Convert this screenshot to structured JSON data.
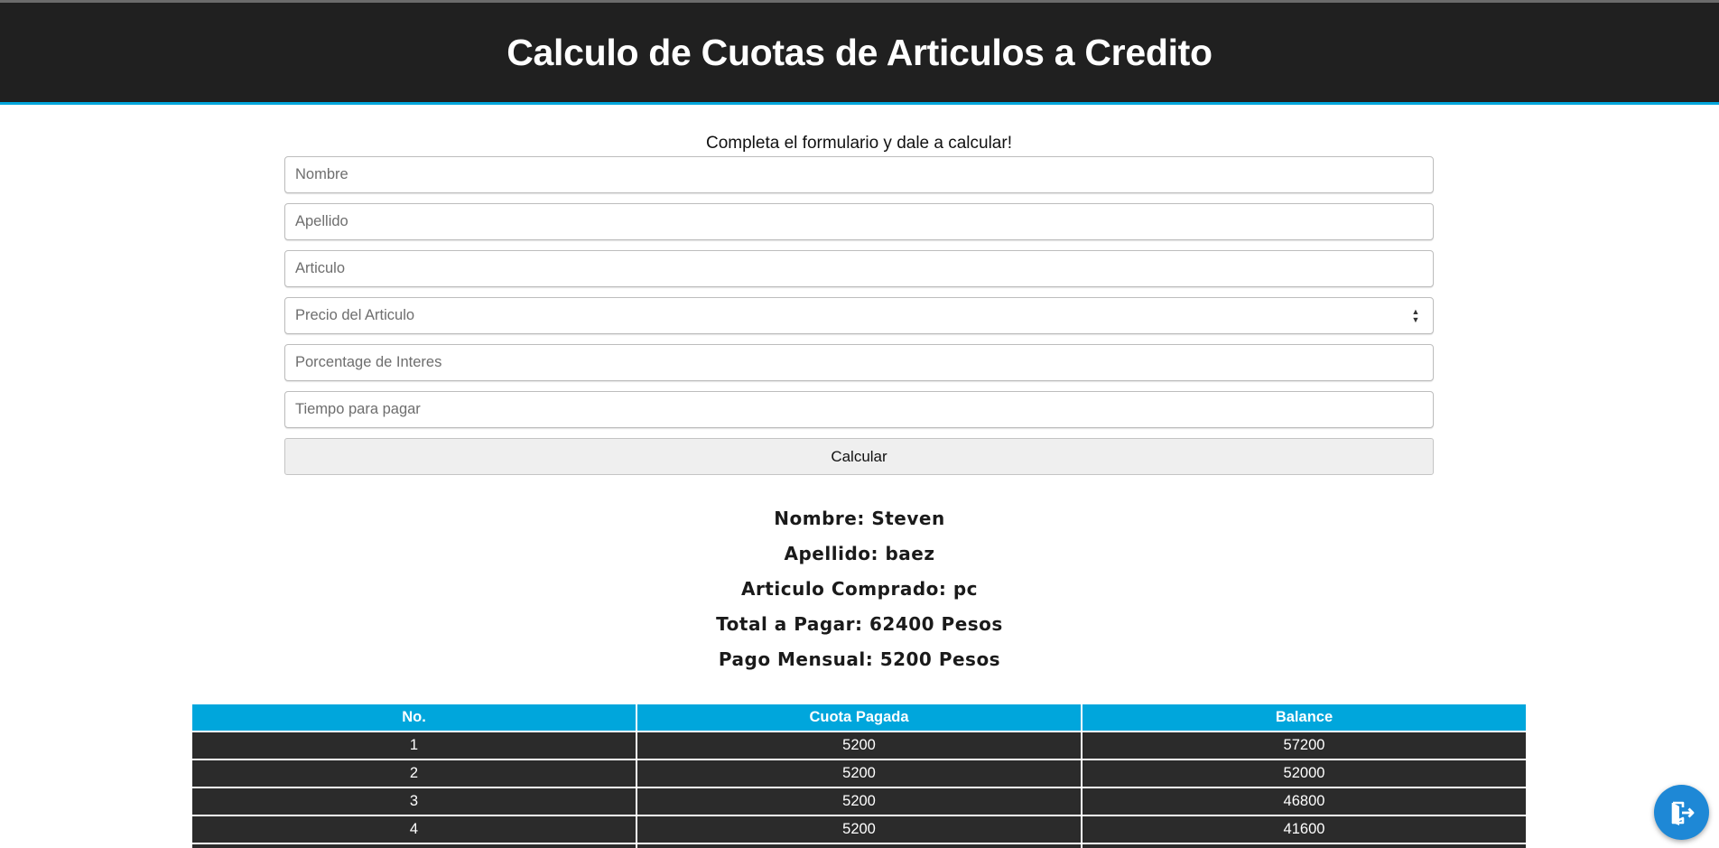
{
  "header": {
    "title": "Calculo de Cuotas de Articulos a Credito"
  },
  "form": {
    "prompt": "Completa el formulario y dale a calcular!",
    "fields": {
      "nombre": {
        "placeholder": "Nombre",
        "value": ""
      },
      "apellido": {
        "placeholder": "Apellido",
        "value": ""
      },
      "articulo": {
        "placeholder": "Articulo",
        "value": ""
      },
      "precio": {
        "placeholder": "Precio del Articulo",
        "value": ""
      },
      "interes": {
        "placeholder": "Porcentage de Interes",
        "value": ""
      },
      "tiempo": {
        "placeholder": "Tiempo para pagar",
        "value": ""
      }
    },
    "submit_label": "Calcular"
  },
  "results": {
    "nombre": "Nombre: Steven",
    "apellido": "Apellido: baez",
    "articulo": "Articulo Comprado: pc",
    "total": "Total a Pagar: 62400 Pesos",
    "mensual": "Pago Mensual: 5200 Pesos"
  },
  "table": {
    "headers": [
      "No.",
      "Cuota Pagada",
      "Balance"
    ],
    "rows": [
      [
        "1",
        "5200",
        "57200"
      ],
      [
        "2",
        "5200",
        "52000"
      ],
      [
        "3",
        "5200",
        "46800"
      ],
      [
        "4",
        "5200",
        "41600"
      ],
      [
        "",
        "",
        ""
      ]
    ]
  },
  "fab": {
    "icon": "exit-icon"
  },
  "colors": {
    "header_bg": "#202020",
    "accent": "#00a6dc",
    "row_bg": "#2b2b2b",
    "fab_bg": "#1e88d6"
  }
}
